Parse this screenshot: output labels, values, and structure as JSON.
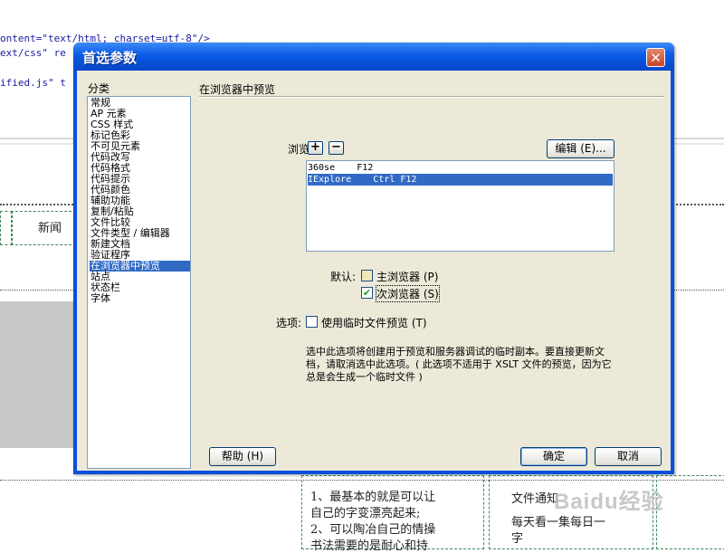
{
  "background": {
    "code_lines": [
      "ontent=\"text/html; charset=utf-8\"/>",
      "ext/css\" re",
      "ified.js\" t"
    ],
    "nav_text": "新闻",
    "content_lines": [
      "1、最基本的就是可以让",
      "自己的字变漂亮起来;",
      "2、可以陶冶自己的情操",
      "书法需要的是耐心和持"
    ],
    "right_lines": [
      "文件通知",
      "每天看一集每日一",
      "字"
    ],
    "watermark": "Baidu经验"
  },
  "dialog": {
    "title": "首选参数",
    "close_glyph": "✕",
    "category_label": "分类",
    "categories": [
      "常规",
      "AP 元素",
      "CSS 样式",
      "标记色彩",
      "不可见元素",
      "代码改写",
      "代码格式",
      "代码提示",
      "代码颜色",
      "辅助功能",
      "复制/粘贴",
      "文件比较",
      "文件类型 / 编辑器",
      "新建文档",
      "验证程序",
      "在浏览器中预览",
      "站点",
      "状态栏",
      "字体"
    ],
    "selected_category_index": 15,
    "section_title": "在浏览器中预览",
    "browsers_label": "浏览器:",
    "add_glyph": "+",
    "remove_glyph": "−",
    "edit_button": "编辑 (E)...",
    "browser_list": [
      {
        "name": "360se",
        "shortcut": "F12",
        "selected": false
      },
      {
        "name": "IExplore",
        "shortcut": "Ctrl F12",
        "selected": true
      }
    ],
    "default_label": "默认:",
    "primary_browser": {
      "label": "主浏览器 (P)",
      "checked": false
    },
    "secondary_browser": {
      "label": "次浏览器 (S)",
      "checked": true
    },
    "options_label": "选项:",
    "temp_file_option": {
      "label": "使用临时文件预览 (T)",
      "checked": false
    },
    "description": "选中此选项将创建用于预览和服务器调试的临时副本。要直接更新文档，请取消选中此选项。( 此选项不适用于 XSLT 文件的预览，因为它总是会生成一个临时文件 )",
    "help_button": "帮助 (H)",
    "ok_button": "确定",
    "cancel_button": "取消"
  },
  "colors": {
    "title_blue": "#0a5ae6",
    "selection": "#316ac5",
    "dialog_face": "#ece9d8",
    "close_red": "#c8452a"
  }
}
